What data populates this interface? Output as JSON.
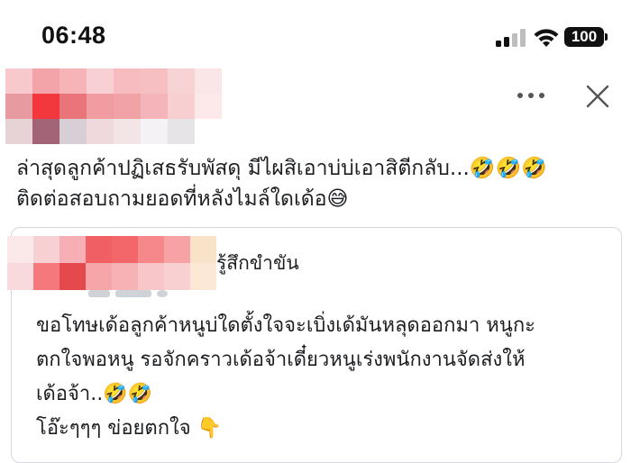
{
  "status_bar": {
    "time": "06:48",
    "battery_level": "100",
    "icons": [
      "signal-icon",
      "wifi-icon",
      "battery-icon"
    ]
  },
  "post": {
    "header_icons": [
      "more-options-icon",
      "close-icon"
    ],
    "text_line_1": "ล่าสุดลูกค้าปฏิเสธรับพัสดุ มีไผสิเอาบ่บ่เอาสิตีกลับ...🤣🤣🤣",
    "text_line_2": "ติดต่อสอบถามยอดที่หลังไมล์ใดเด้อ😅"
  },
  "shared_post": {
    "feeling_label": "รู้สึกขำขัน",
    "line_1": "ขอโทษเด้อลูกค้าหนูบ่ใดตั้งใจจะเบิ่งเด้มันหลุดออกมา หนูกะ",
    "line_2": "ตกใจพอหนู รอจักคราวเด้อจ้าเดี๋ยวหนูเร่งพนักงานจัดส่งให้",
    "line_3": "เด้อจ้า..🤣🤣",
    "line_4": "โอ๊ะๆๆๆ ข่อยตกใจ 👇"
  },
  "colors": {
    "text": "#1c1e21",
    "border": "#d6d8dc",
    "icon_gray": "#555555"
  }
}
